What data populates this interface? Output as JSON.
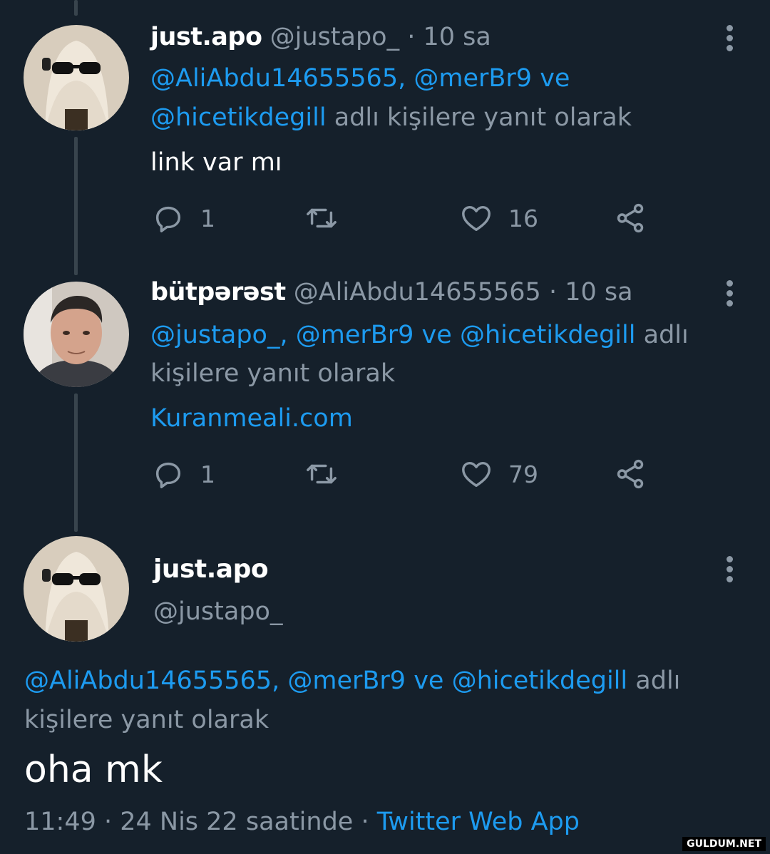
{
  "tweets": [
    {
      "name": "just.apo",
      "handle": "@justapo_",
      "time": "· 10 sa",
      "reply_to": [
        "@AliAbdu14655565,",
        "@merBr9",
        "ve",
        "@hicetikdegill",
        "adlı kişilere yanıt olarak"
      ],
      "text": "link var mı",
      "replies": "1",
      "likes": "16"
    },
    {
      "name": "bütpərəst",
      "handle": "@AliAbdu14655565",
      "time": "· 10 sa",
      "reply_to": [
        "@justapo_,",
        "@merBr9",
        "ve",
        "@hicetikdegill",
        "adlı",
        "kişilere yanıt olarak"
      ],
      "text": "Kuranmeali.com",
      "replies": "1",
      "likes": "79"
    }
  ],
  "main_tweet": {
    "name": "just.apo",
    "handle": "@justapo_",
    "reply_to": [
      "@AliAbdu14655565,",
      "@merBr9",
      "ve",
      "@hicetikdegill",
      "adlı",
      "kişilere yanıt olarak"
    ],
    "text": "oha mk",
    "time": "11:49 · 24 Nis 22 saatinde ·",
    "source": "Twitter Web App"
  },
  "watermark": "GULDUM.NET",
  "icons": [
    "reply-icon",
    "retweet-icon",
    "like-icon",
    "share-icon",
    "more-icon"
  ],
  "colors": {
    "background": "#15202b",
    "link": "#1d9bf0",
    "muted": "#8b98a5",
    "thread_line": "#38444d"
  }
}
